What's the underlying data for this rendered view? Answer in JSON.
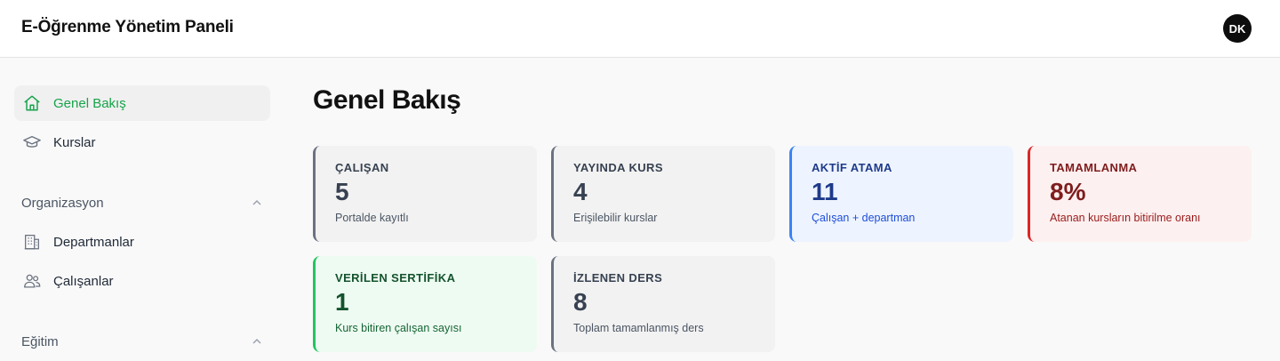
{
  "header": {
    "app_title": "E-Öğrenme Yönetim Paneli",
    "avatar_initials": "DK"
  },
  "sidebar": {
    "items": [
      {
        "label": "Genel Bakış",
        "icon": "home-icon",
        "active": true
      },
      {
        "label": "Kurslar",
        "icon": "graduation-cap-icon",
        "active": false
      }
    ],
    "groups": [
      {
        "title": "Organizasyon",
        "expanded": true,
        "items": [
          {
            "label": "Departmanlar",
            "icon": "building-icon"
          },
          {
            "label": "Çalışanlar",
            "icon": "users-icon"
          }
        ]
      },
      {
        "title": "Eğitim",
        "expanded": true,
        "items": []
      }
    ]
  },
  "main": {
    "title": "Genel Bakış",
    "cards": [
      {
        "label": "ÇALIŞAN",
        "value": "5",
        "sub": "Portalde kayıtlı",
        "color": "gray"
      },
      {
        "label": "YAYINDA KURS",
        "value": "4",
        "sub": "Erişilebilir kurslar",
        "color": "gray"
      },
      {
        "label": "AKTİF ATAMA",
        "value": "11",
        "sub": "Çalışan + departman",
        "color": "blue"
      },
      {
        "label": "TAMAMLANMA",
        "value": "8%",
        "sub": "Atanan kursların bitirilme oranı",
        "color": "red"
      },
      {
        "label": "VERİLEN SERTİFİKA",
        "value": "1",
        "sub": "Kurs bitiren çalışan sayısı",
        "color": "green"
      },
      {
        "label": "İZLENEN DERS",
        "value": "8",
        "sub": "Toplam tamamlanmış ders",
        "color": "gray"
      }
    ]
  },
  "colors": {
    "accent": "#16a34a",
    "blue": "#3b82f6",
    "red": "#dc2626",
    "green": "#22c55e",
    "gray": "#6b7280"
  }
}
